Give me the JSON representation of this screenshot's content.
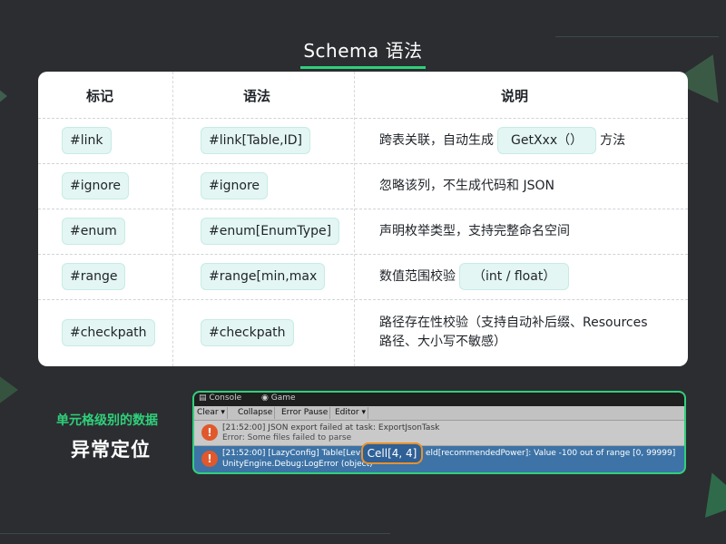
{
  "title": "Schema 语法",
  "table": {
    "headers": [
      "标记",
      "语法",
      "说明"
    ],
    "rows": [
      {
        "tag": "#link",
        "syntax": "#link[Table,ID]",
        "desc_pre": "跨表关联，自动生成",
        "desc_tag": "GetXxx（）",
        "desc_post": "方法"
      },
      {
        "tag": "#ignore",
        "syntax": "#ignore",
        "desc": "忽略该列，不生成代码和 JSON"
      },
      {
        "tag": "#enum",
        "syntax": "#enum[EnumType]",
        "desc": "声明枚举类型，支持完整命名空间"
      },
      {
        "tag": "#range",
        "syntax": "#range[min,max",
        "desc_pre": "数值范围校验",
        "desc_tag": "（int / float）"
      },
      {
        "tag": "#checkpath",
        "syntax": "#checkpath",
        "desc_line1": "路径存在性校验（支持自动补后缀、Resources",
        "desc_line2": "路径、大小写不敏感）"
      }
    ]
  },
  "side": {
    "line1": "单元格级别的数据",
    "line2": "异常定位"
  },
  "console": {
    "tabs": [
      "Console",
      "Game"
    ],
    "toolbar": [
      "Clear",
      "Collapse",
      "Error Pause",
      "Editor"
    ],
    "logs": [
      {
        "line1": "[21:52:00] JSON export failed at task: ExportJsonTask",
        "line2": "Error: Some files failed to parse"
      },
      {
        "line1a": "[21:52:00] [LazyConfig] Table[Lev",
        "line1b": "eld[recommendedPower]: Value -100 out of range [0, 99999]",
        "line2": "UnityEngine.Debug:LogError (object)"
      }
    ],
    "highlight": "Cell[4, 4]"
  },
  "colors": {
    "accent": "#2fd07a",
    "highlight": "#e8912e",
    "error_icon": "#e0582c",
    "selected_row": "#3d73a6"
  }
}
